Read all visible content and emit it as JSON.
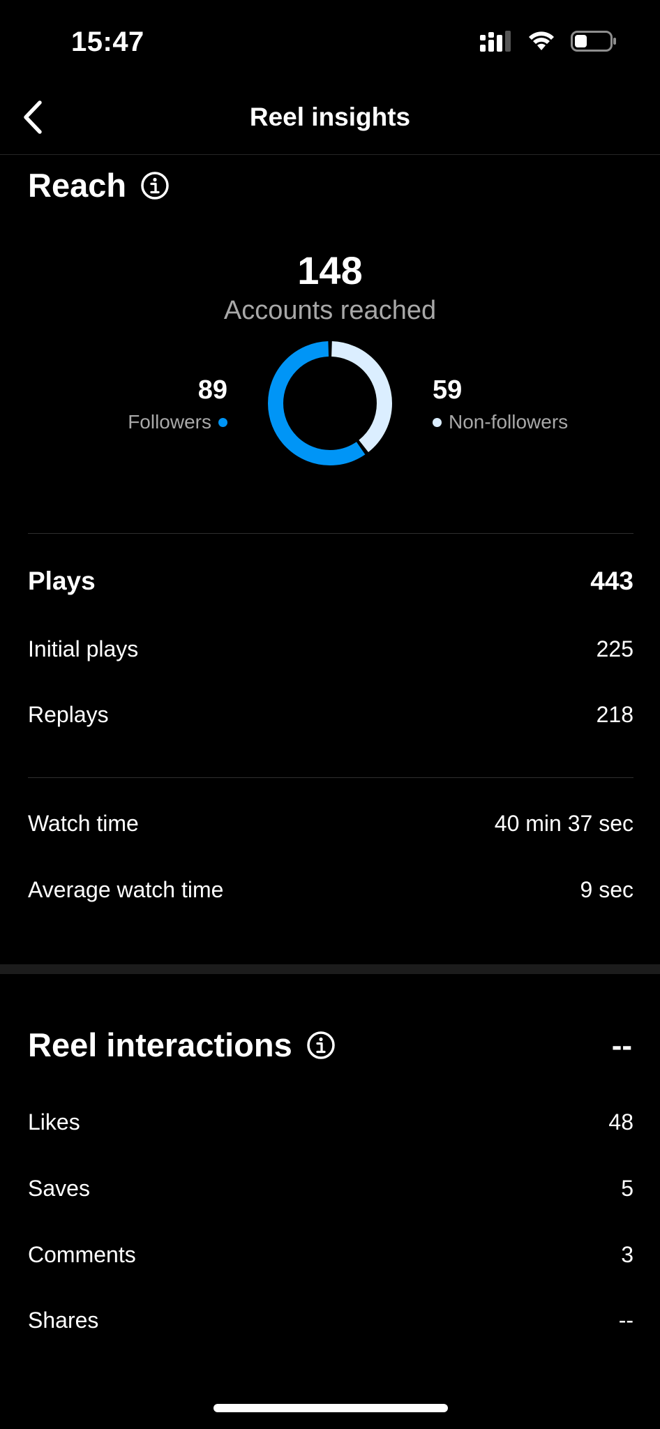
{
  "status_bar": {
    "time": "15:47",
    "battery_level": 0.35
  },
  "nav": {
    "title": "Reel insights"
  },
  "reach": {
    "title": "Reach",
    "accounts_reached": "148",
    "accounts_reached_label": "Accounts reached",
    "followers_value": "89",
    "followers_label": "Followers",
    "non_followers_value": "59",
    "non_followers_label": "Non-followers",
    "followers_color": "#0095f6",
    "non_followers_color": "#dbeeff",
    "followers_share": 0.601
  },
  "plays": {
    "label": "Plays",
    "value": "443",
    "initial_label": "Initial plays",
    "initial_value": "225",
    "replays_label": "Replays",
    "replays_value": "218"
  },
  "watch": {
    "time_label": "Watch time",
    "time_value": "40 min 37 sec",
    "avg_label": "Average watch time",
    "avg_value": "9 sec"
  },
  "interactions": {
    "title": "Reel interactions",
    "total": "--",
    "likes_label": "Likes",
    "likes_value": "48",
    "saves_label": "Saves",
    "saves_value": "5",
    "comments_label": "Comments",
    "comments_value": "3",
    "shares_label": "Shares",
    "shares_value": "--"
  }
}
